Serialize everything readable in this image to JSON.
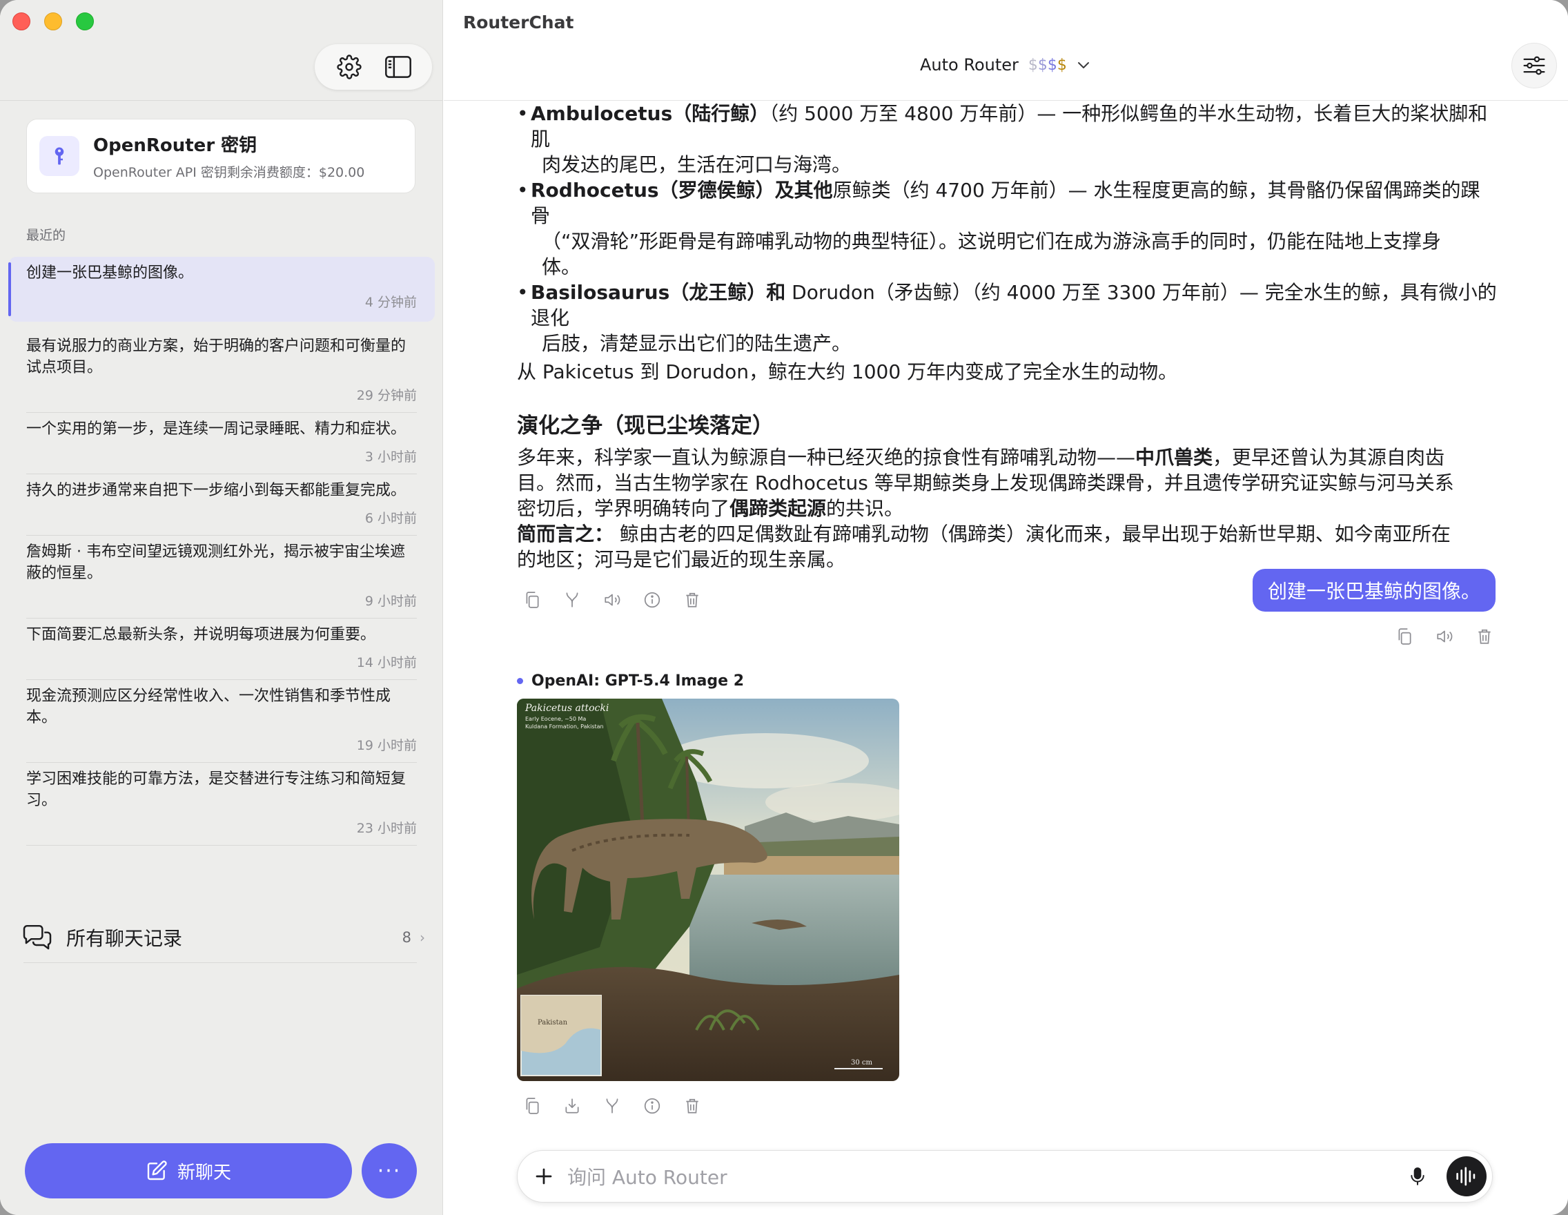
{
  "window": {
    "app_title": "RouterChat"
  },
  "sidebar": {
    "key_card": {
      "title": "OpenRouter 密钥",
      "subtitle": "OpenRouter API 密钥剩余消费额度：$20.00"
    },
    "recent_label": "最近的",
    "conversations": [
      {
        "title": "创建一张巴基鲸的图像。",
        "time": "4 分钟前",
        "active": true
      },
      {
        "title": "最有说服力的商业方案，始于明确的客户问题和可衡量的试点项目。",
        "time": "29 分钟前"
      },
      {
        "title": "一个实用的第一步，是连续一周记录睡眠、精力和症状。",
        "time": "3 小时前"
      },
      {
        "title": "持久的进步通常来自把下一步缩小到每天都能重复完成。",
        "time": "6 小时前"
      },
      {
        "title": "詹姆斯 · 韦布空间望远镜观测红外光，揭示被宇宙尘埃遮蔽的恒星。",
        "time": "9 小时前"
      },
      {
        "title": "下面简要汇总最新头条，并说明每项进展为何重要。",
        "time": "14 小时前"
      },
      {
        "title": "现金流预测应区分经常性收入、一次性销售和季节性成本。",
        "time": "19 小时前"
      },
      {
        "title": "学习困难技能的可靠方法，是交替进行专注练习和简短复习。",
        "time": "23 小时前"
      }
    ],
    "all_chats": {
      "label": "所有聊天记录",
      "count": "8"
    },
    "new_chat_label": "新聊天",
    "more_label": "···"
  },
  "header": {
    "model_name": "Auto Router",
    "price": [
      "$",
      "$",
      "$",
      "$"
    ]
  },
  "message": {
    "b1_bold": "Ambulocetus（陆行鲸）",
    "b1_rest": "（约 5000 万至 4800 万年前）— 一种形似鳄鱼的半水生动物，长着巨大的桨状脚和肌",
    "b1_cont": "肉发达的尾巴，生活在河口与海湾。",
    "b2_bold": "Rodhocetus（罗德侯鲸）及其他",
    "b2_rest": "原鲸类（约 4700 万年前）— 水生程度更高的鲸，其骨骼仍保留偶蹄类的踝骨",
    "b2_cont1": "（“双滑轮”形距骨是有蹄哺乳动物的典型特征）。这说明它们在成为游泳高手的同时，仍能在陆地上支撑身",
    "b2_cont2": "体。",
    "b3_bold": "Basilosaurus（龙王鲸）和",
    "b3_rest": " Dorudon（矛齿鲸）（约 4000 万至 3300 万年前）— 完全水生的鲸，具有微小的退化",
    "b3_cont": "后肢，清楚显示出它们的陆生遗产。",
    "summary_line": "从 Pakicetus 到 Dorudon，鲸在大约 1000 万年内变成了完全水生的动物。",
    "heading": "演化之争（现已尘埃落定）",
    "p1_a": "多年来，科学家一直认为鲸源自一种已经灭绝的掠食性有蹄哺乳动物——",
    "p1_bold": "中爪兽类",
    "p1_b": "，更早还曾认为其源自肉齿",
    "p1_line2": "目。然而，当古生物学家在 Rodhocetus 等早期鲸类身上发现偶蹄类踝骨，并且遗传学研究证实鲸与河马关系",
    "p1_line3_a": "密切后，学界明确转向了",
    "p1_line3_bold": "偶蹄类起源",
    "p1_line3_b": "的共识。",
    "p2_bold": "简而言之：",
    "p2_rest": " 鲸由古老的四足偶数趾有蹄哺乳动物（偶蹄类）演化而来，最早出现于始新世早期、如今南亚所在",
    "p2_line2": "的地区；河马是它们最近的现生亲属。"
  },
  "user_message": "创建一张巴基鲸的图像。",
  "response_model": "OpenAI: GPT-5.4 Image 2",
  "image": {
    "caption_title": "Pakicetus attocki",
    "caption_line1": "Early Eocene, ~50 Ma",
    "caption_line2": "Kuldana Formation, Pakistan",
    "map_label": "Pakistan",
    "scale_label": "30 cm"
  },
  "input": {
    "placeholder": "询问 Auto Router"
  },
  "colors": {
    "accent": "#6366f1",
    "sidebar_bg": "#ededeb"
  }
}
